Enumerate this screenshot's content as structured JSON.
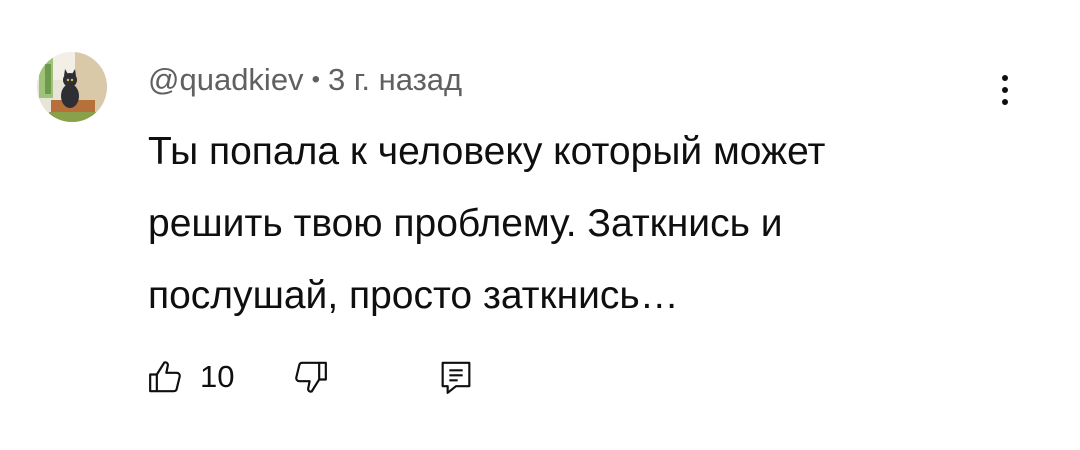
{
  "comment": {
    "author": "@quadkiev",
    "separator": "•",
    "time": "3 г. назад",
    "text_lines": [
      "Ты попала к человеку который может",
      "решить твою проблему. Заткнись и",
      "послушай, просто заткнись…"
    ],
    "likes": "10"
  },
  "icons": {
    "avatar": "cat-avatar",
    "menu": "more-vertical-icon",
    "like": "thumb-up-icon",
    "dislike": "thumb-down-icon",
    "reply": "reply-comment-icon"
  },
  "colors": {
    "text": "#0f0f0f",
    "meta": "#606060"
  }
}
